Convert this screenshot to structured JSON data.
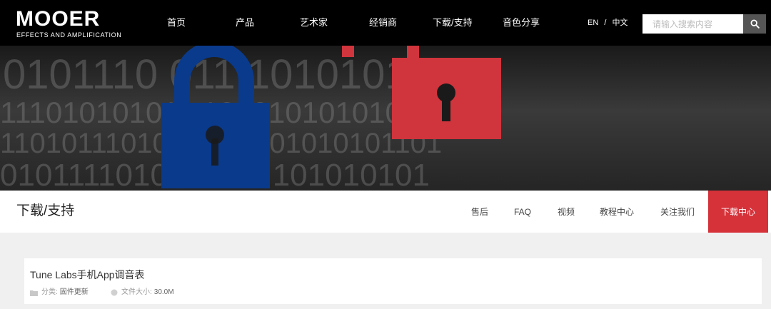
{
  "header": {
    "logo_main": "MOOER",
    "logo_sub": "EFFECTS AND AMPLIFICATION",
    "nav": [
      "首页",
      "产品",
      "艺术家",
      "经销商",
      "下载/支持",
      "音色分享"
    ],
    "lang_en": "EN",
    "lang_sep": "/",
    "lang_zh": "中文",
    "search_placeholder": "请输入搜索内容"
  },
  "banner": {
    "binary_rows": [
      "0101110 011 1010101011",
      "111010101011 101010101010",
      "1101011101001011 101010101101",
      "010111101010 010 101010101"
    ],
    "lock_blue": "#0a3a8c",
    "lock_red": "#d0343c"
  },
  "subnav": {
    "title": "下载/支持",
    "items": [
      "售后",
      "FAQ",
      "视频",
      "教程中心",
      "关注我们"
    ],
    "active": "下载中心",
    "active_color": "#d5323a"
  },
  "download": {
    "title": "Tune Labs手机App调音表",
    "category_label": "分类:",
    "category_value": "固件更新",
    "size_label": "文件大小:",
    "size_value": "30.0M"
  }
}
